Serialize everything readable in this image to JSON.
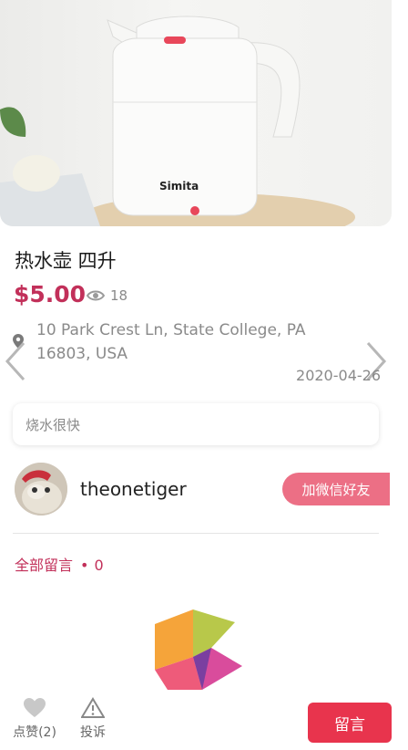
{
  "product": {
    "image_brand_text": "Simita",
    "title": "热水壶 四升",
    "price": "$5.00",
    "views": "18",
    "address": "10 Park Crest Ln, State College, PA 16803, USA",
    "date": "2020-04-26",
    "description": "烧水很快"
  },
  "seller": {
    "username": "theonetiger",
    "add_wechat_label": "加微信好友"
  },
  "comments": {
    "label": "全部留言",
    "separator": "•",
    "count": "0"
  },
  "bottom_bar": {
    "like_label": "点赞(2)",
    "report_label": "投诉",
    "comment_label": "留言"
  },
  "colors": {
    "accent": "#c2305a",
    "button_pink": "#ec6f85",
    "comment_red": "#e8344d"
  },
  "icons": [
    "eye-icon",
    "location-pin-icon",
    "chevron-left-icon",
    "chevron-right-icon",
    "heart-icon",
    "warning-icon",
    "app-logo-icon"
  ]
}
